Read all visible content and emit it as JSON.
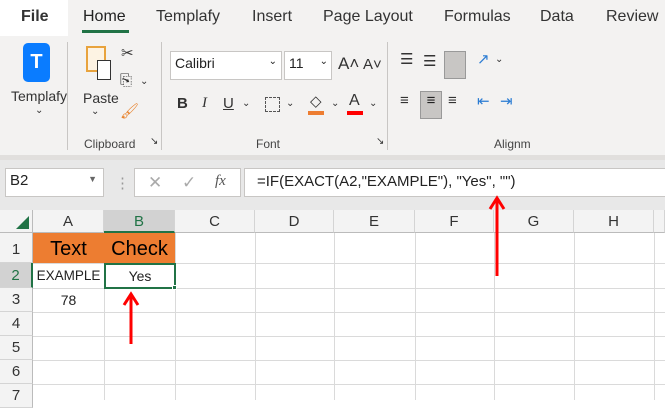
{
  "tabs": [
    "File",
    "Home",
    "Templafy",
    "Insert",
    "Page Layout",
    "Formulas",
    "Data",
    "Review"
  ],
  "ribbon": {
    "templafy_label": "Templafy",
    "templafy_logo": "T",
    "paste_label": "Paste",
    "clipboard_group": "Clipboard",
    "font_name": "Calibri",
    "font_size": "11",
    "font_group": "Font",
    "bold": "B",
    "italic": "I",
    "underline": "U",
    "alignment_group": "Alignm"
  },
  "formula_bar": {
    "name_box": "B2",
    "fx": "fx",
    "formula": "=IF(EXACT(A2,\"EXAMPLE\"), \"Yes\", \"\")"
  },
  "columns": [
    "A",
    "B",
    "C",
    "D",
    "E",
    "F",
    "G",
    "H"
  ],
  "rows": [
    "1",
    "2",
    "3",
    "4",
    "5",
    "6",
    "7"
  ],
  "cells": {
    "A1": "Text",
    "B1": "Check",
    "A2": "EXAMPLE",
    "B2": "Yes",
    "A3": "78"
  },
  "colors": {
    "accent": "#217346",
    "header_fill": "#ed7d31",
    "arrow": "#ff0000",
    "fill_color": "#ed7d31",
    "font_color": "#ff0000"
  }
}
